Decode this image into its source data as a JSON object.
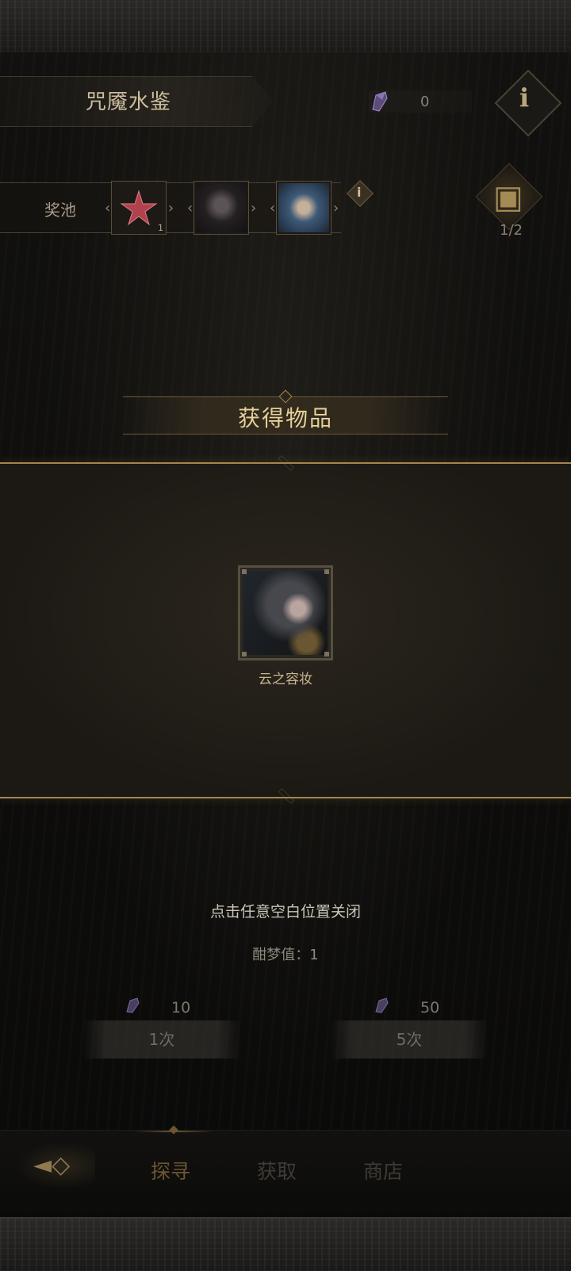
{
  "header": {
    "title": "咒魇水鉴",
    "currency_value": "0",
    "currency_icon": "crystal-shard-icon",
    "info_icon": "info-icon"
  },
  "prize_pool": {
    "label": "奖池",
    "items": [
      {
        "name": "red-star-item-icon",
        "count": "1"
      },
      {
        "name": "dark-portrait-item-icon",
        "count": ""
      },
      {
        "name": "blue-portrait-item-icon",
        "count": ""
      }
    ],
    "chest_progress": "1/2"
  },
  "modal": {
    "title": "获得物品",
    "reward": {
      "label": "云之容妆",
      "icon": "portrait-reward-icon"
    }
  },
  "hint": "点击任意空白位置关闭",
  "dream_value": "酣梦值：1",
  "draw_options": [
    {
      "cost": "10",
      "label": "1次"
    },
    {
      "cost": "50",
      "label": "5次"
    }
  ],
  "nav": {
    "tabs": [
      "探寻",
      "获取",
      "商店"
    ],
    "active_index": 0
  },
  "colors": {
    "accent": "#a3864f",
    "title_gold": "#e6cf98"
  }
}
